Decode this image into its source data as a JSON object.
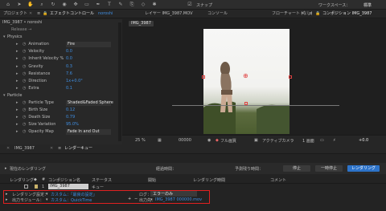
{
  "toolbar": {
    "snap_label": "スナップ",
    "workspace_label": "ワークスペース：",
    "workspace_value": "標準"
  },
  "effects_panel": {
    "tab_project": "プロジェクト",
    "tab_effect_controls": "エフェクトコントロール",
    "layer_name": "noroshi",
    "breadcrumb": "IMG_3987 • noroshi",
    "rows": [
      {
        "indent": 0,
        "label": "Physics",
        "expand": true
      },
      {
        "indent": 1,
        "label": "Animation",
        "value": "Fire"
      },
      {
        "indent": 1,
        "label": "Velocity",
        "value": "0.0"
      },
      {
        "indent": 1,
        "label": "Inherit Velocity %",
        "value": "0.0"
      },
      {
        "indent": 1,
        "label": "Gravity",
        "value": "0.3"
      },
      {
        "indent": 1,
        "label": "Resistance",
        "value": "7.6"
      },
      {
        "indent": 1,
        "label": "Direction",
        "value": "1x+0.0°"
      },
      {
        "indent": 1,
        "label": "Extra",
        "value": "0.1"
      },
      {
        "indent": 0,
        "label": "Particle",
        "expand": true
      },
      {
        "indent": 1,
        "label": "Particle Type",
        "value": "Shaded&Faded Sphere"
      },
      {
        "indent": 1,
        "label": "Birth Size",
        "value": "0.12"
      },
      {
        "indent": 1,
        "label": "Death Size",
        "value": "0.79"
      },
      {
        "indent": 1,
        "label": "Size Variation",
        "value": "95.0%"
      },
      {
        "indent": 1,
        "label": "Opacity Map",
        "value": "Fade In and Out"
      }
    ]
  },
  "viewer": {
    "tab_layer": "レイヤー IMG_3987.MOV",
    "tab_console": "コンソール",
    "tab_flowchart": "フローチャート (なし)",
    "tab_composition": "コンポジション IMG_3987",
    "comp_chip": "IMG_3987",
    "zoom": "25 %",
    "timecode": "00000",
    "quality": "フル画質",
    "camera": "アクティブカメラ",
    "views": "1 画面",
    "exposure": "+0.0"
  },
  "timeline_tabs": {
    "tab_comp": "IMG_3987",
    "tab_render_queue": "レンダーキュー"
  },
  "render_queue": {
    "current_render_label": "現在のレンダリング",
    "elapsed_label": "経過時間：",
    "remaining_label": "予測残り時間：",
    "stop_button": "停止",
    "pause_button": "一時停止",
    "render_button": "レンダリング",
    "columns": [
      "レンダリング",
      "#",
      "コンポジション名",
      "ステータス",
      "開始",
      "レンダリング時間",
      "コメント"
    ],
    "item_number": "1",
    "item_comp": "IMG_3987",
    "item_status": "キュー",
    "settings_label": "レンダリング設定：",
    "settings_value": "カスタム：「最良の設定」",
    "output_module_label": "出力モジュール：",
    "output_module_value": "カスタム：QuickTime",
    "log_label": "ログ：",
    "log_value": "エラーのみ",
    "output_to_label": "出力先：",
    "output_to_value": "IMG_3987 000000.mov"
  }
}
